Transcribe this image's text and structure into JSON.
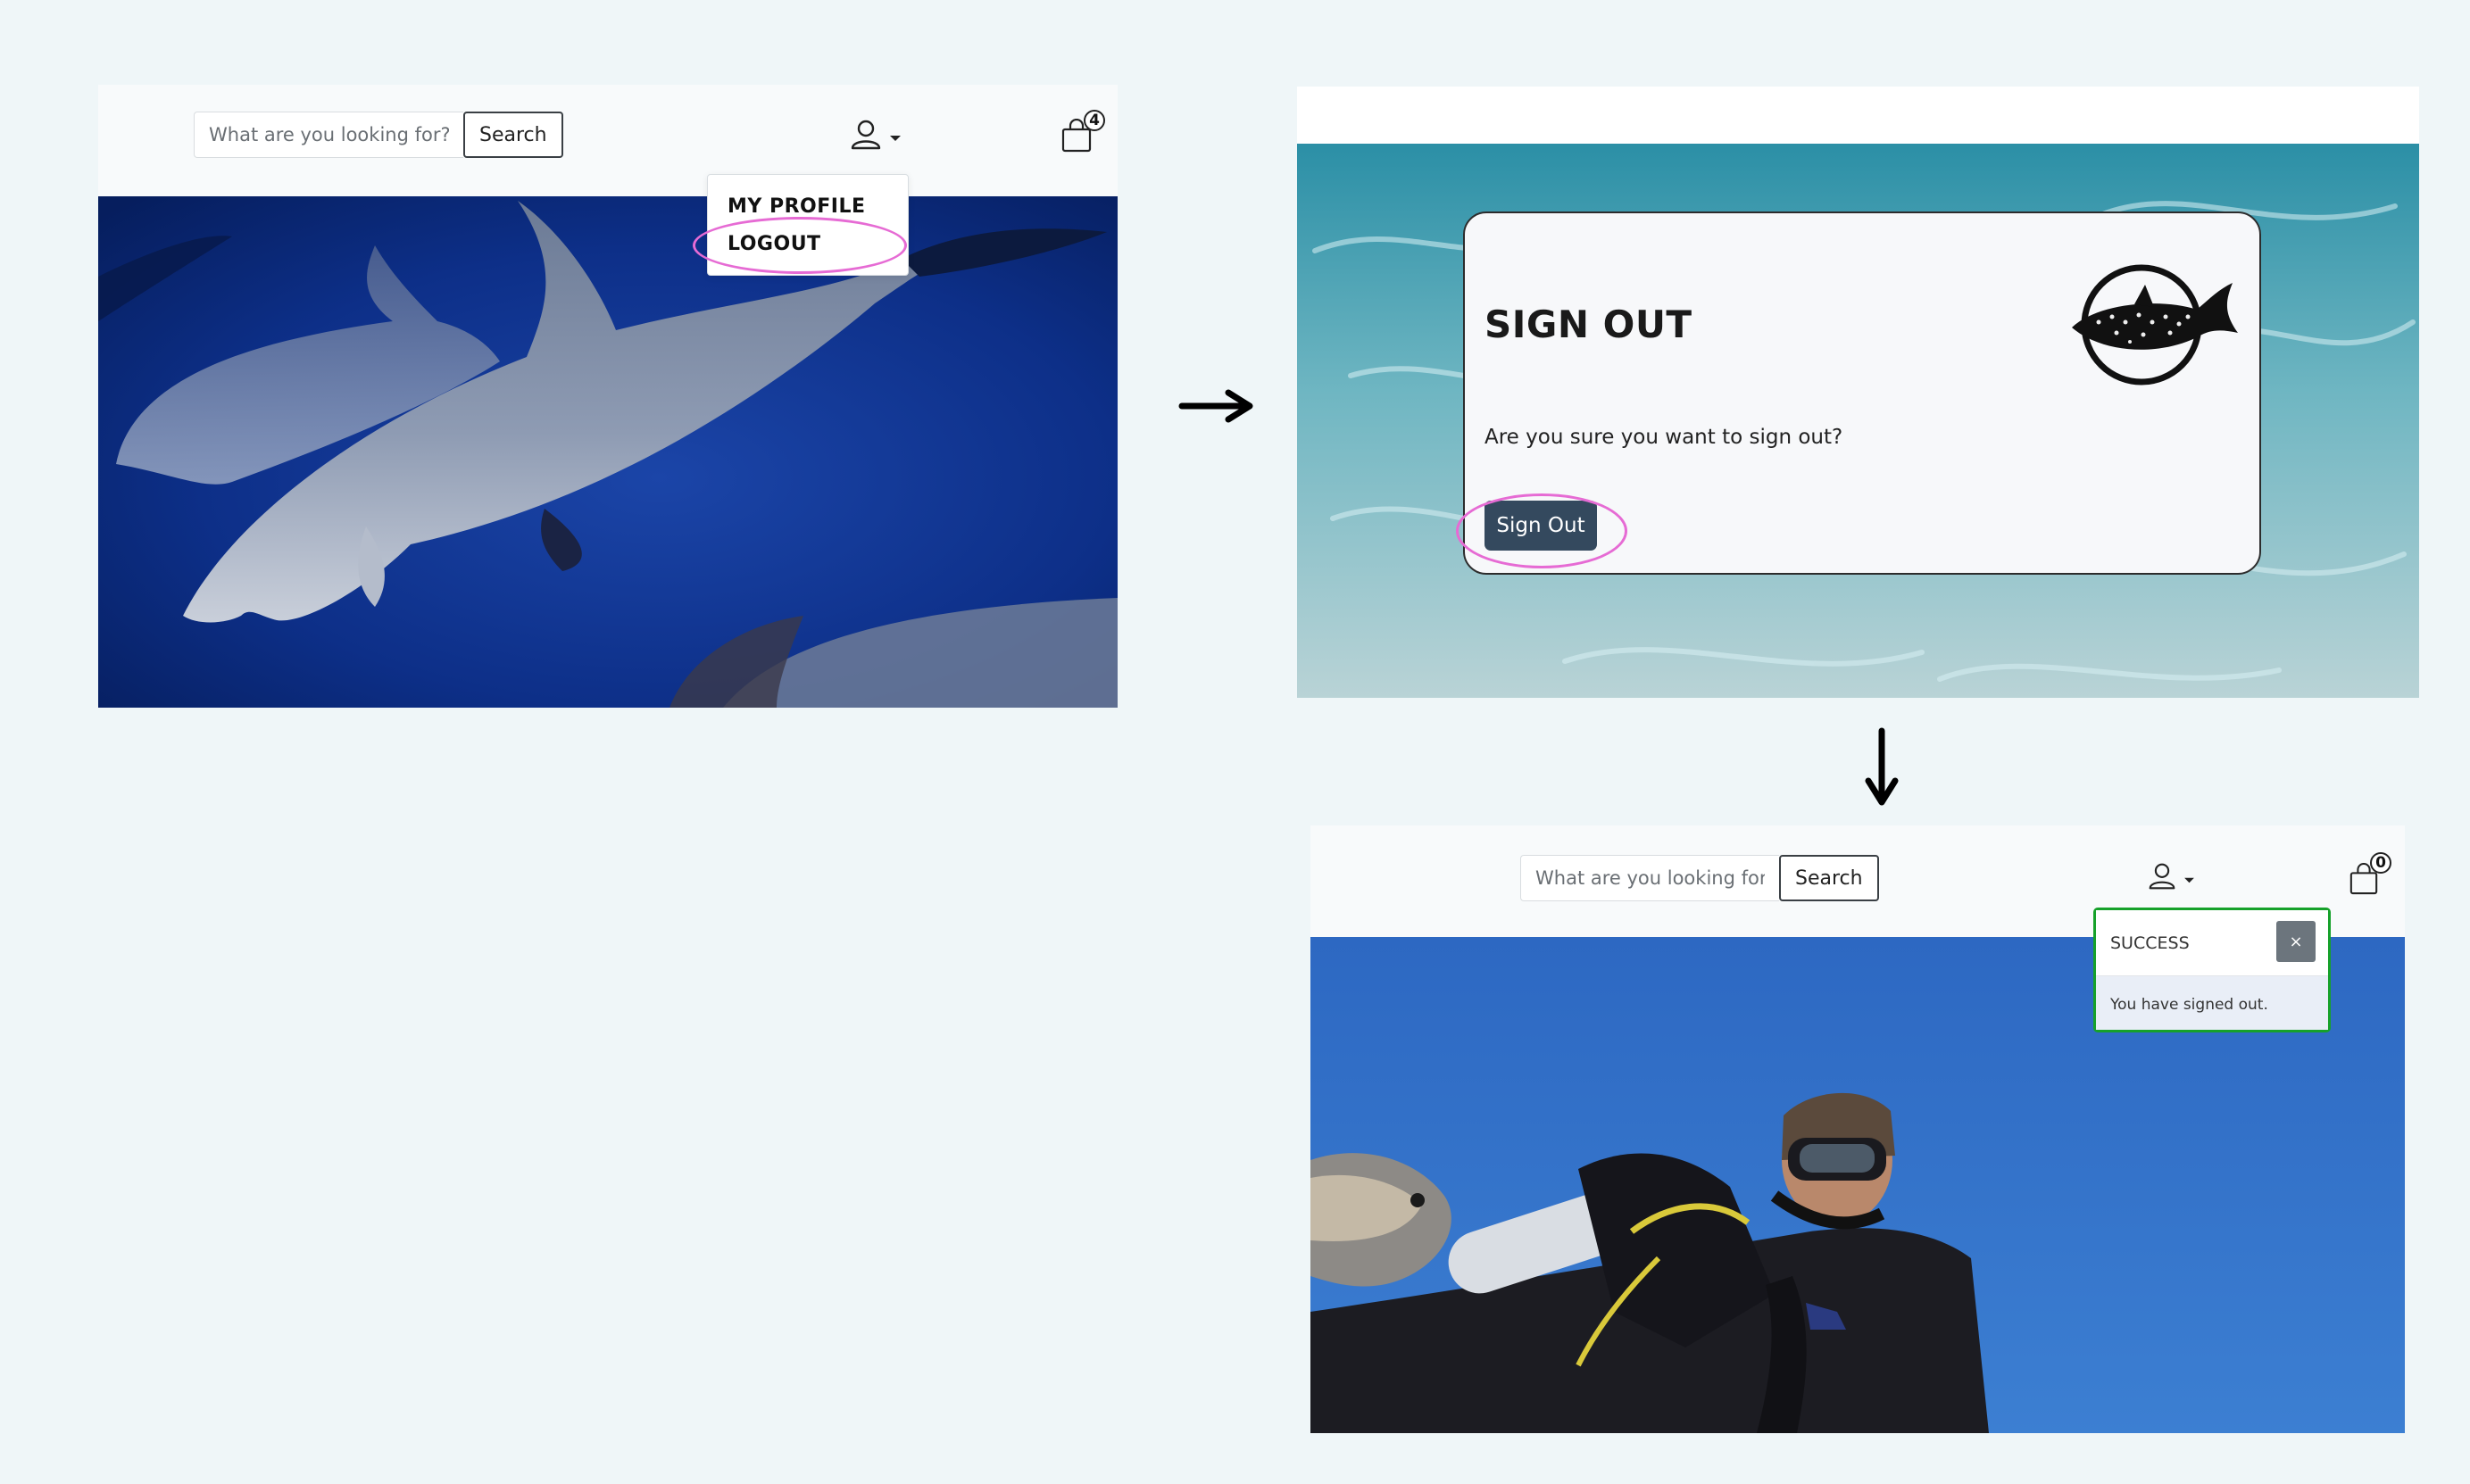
{
  "before": {
    "search": {
      "placeholder": "What are you looking for?",
      "button_label": "Search"
    },
    "cart_count": "4",
    "dropdown": {
      "items": [
        "MY PROFILE",
        "LOGOUT"
      ]
    }
  },
  "signout_page": {
    "title": "SIGN OUT",
    "message": "Are you sure you want to sign out?",
    "button_label": "Sign Out"
  },
  "after": {
    "search": {
      "placeholder": "What are you looking for?",
      "button_label": "Search"
    },
    "cart_count": "0",
    "toast": {
      "title": "SUCCESS",
      "close_label": "×",
      "message": "You have signed out."
    }
  },
  "icons": {
    "user": "user-icon",
    "caret": "caret-down-icon",
    "cart": "shopping-bag-icon",
    "arrow_right": "arrow-right-icon",
    "arrow_down": "arrow-down-icon",
    "logo": "whale-shark-logo-icon"
  },
  "colors": {
    "highlight": "#e66bd4",
    "signout_button": "#34495e",
    "toast_border": "#16a12a",
    "page_background": "#eff6f8"
  }
}
